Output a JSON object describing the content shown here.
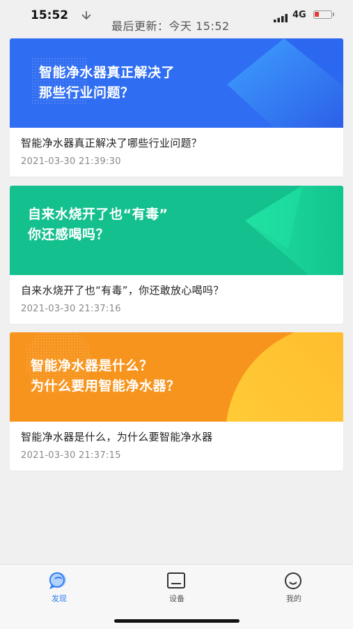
{
  "status_bar": {
    "time": "15:52",
    "network": "4G",
    "colors": {
      "battery_low": "#e53935"
    }
  },
  "header": {
    "update_text": "最后更新：今天 15:52"
  },
  "articles": [
    {
      "banner_lines": [
        "智能净水器真正解决了",
        "那些行业问题？"
      ],
      "title": "智能净水器真正解决了哪些行业问题？",
      "date": "2021-03-30 21:39:30",
      "banner_color": "#2f6df2"
    },
    {
      "banner_lines": [
        "自来水烧开了也“有毒”",
        "你还感喝吗？"
      ],
      "title": "自来水烧开了也“有毒”，你还敢放心喝吗？",
      "date": "2021-03-30 21:37:16",
      "banner_color": "#14c08e"
    },
    {
      "banner_lines": [
        "智能净水器是什么？",
        "为什么要用智能净水器？"
      ],
      "title": "智能净水器是什么，为什么要智能净水器",
      "date": "2021-03-30 21:37:15",
      "banner_color": "#f7941d"
    }
  ],
  "tabs": [
    {
      "label": "发现",
      "icon": "discover-chat-icon",
      "active": true
    },
    {
      "label": "设备",
      "icon": "device-icon",
      "active": false
    },
    {
      "label": "我的",
      "icon": "smiley-profile-icon",
      "active": false
    }
  ],
  "colors": {
    "accent": "#2f7cf6",
    "background": "#f0f0f1"
  }
}
